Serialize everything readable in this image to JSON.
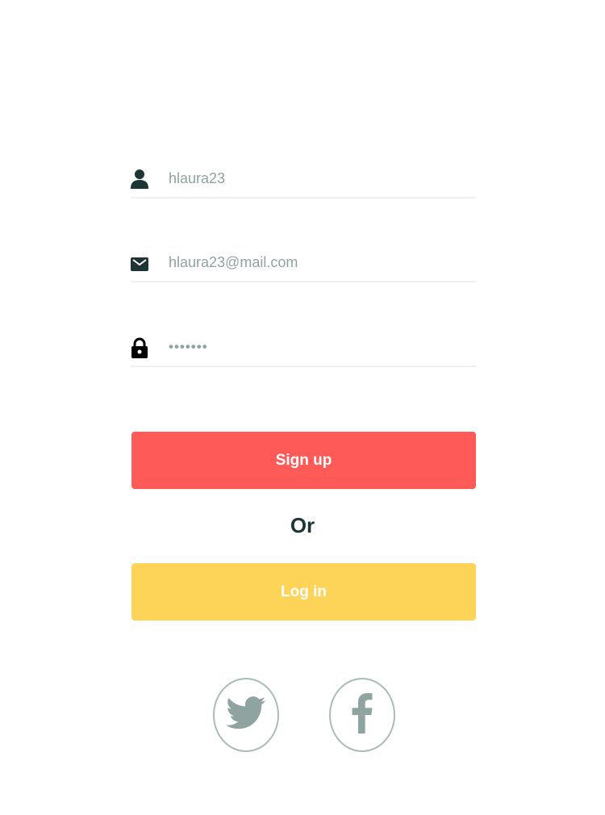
{
  "form": {
    "username": {
      "value": "hlaura23",
      "icon": "user-icon"
    },
    "email": {
      "value": "hlaura23@mail.com",
      "icon": "envelope-icon"
    },
    "password": {
      "value": "•••••••",
      "icon": "lock-icon"
    }
  },
  "actions": {
    "signup_label": "Sign up",
    "separator": "Or",
    "login_label": "Log in"
  },
  "social": {
    "items": [
      {
        "name": "twitter",
        "icon": "twitter-icon"
      },
      {
        "name": "facebook",
        "icon": "facebook-icon"
      }
    ]
  },
  "colors": {
    "signup": "#fe5a57",
    "login": "#fdd458",
    "icon_dark": "#1d3535",
    "input_text": "#8fa3a1",
    "social_outline": "#a9bbb9",
    "divider": "#eef1f1"
  }
}
